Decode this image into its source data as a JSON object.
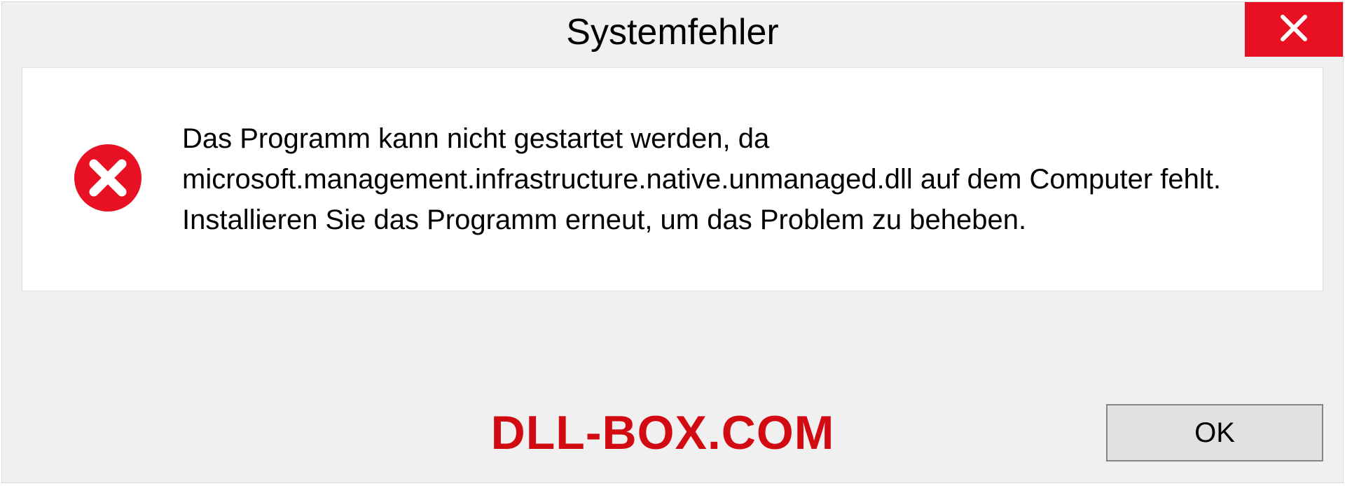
{
  "dialog": {
    "title": "Systemfehler",
    "message": "Das Programm kann nicht gestartet werden, da microsoft.management.infrastructure.native.unmanaged.dll auf dem Computer fehlt. Installieren Sie das Programm erneut, um das Problem zu beheben.",
    "ok_label": "OK"
  },
  "watermark": "DLL-BOX.COM"
}
